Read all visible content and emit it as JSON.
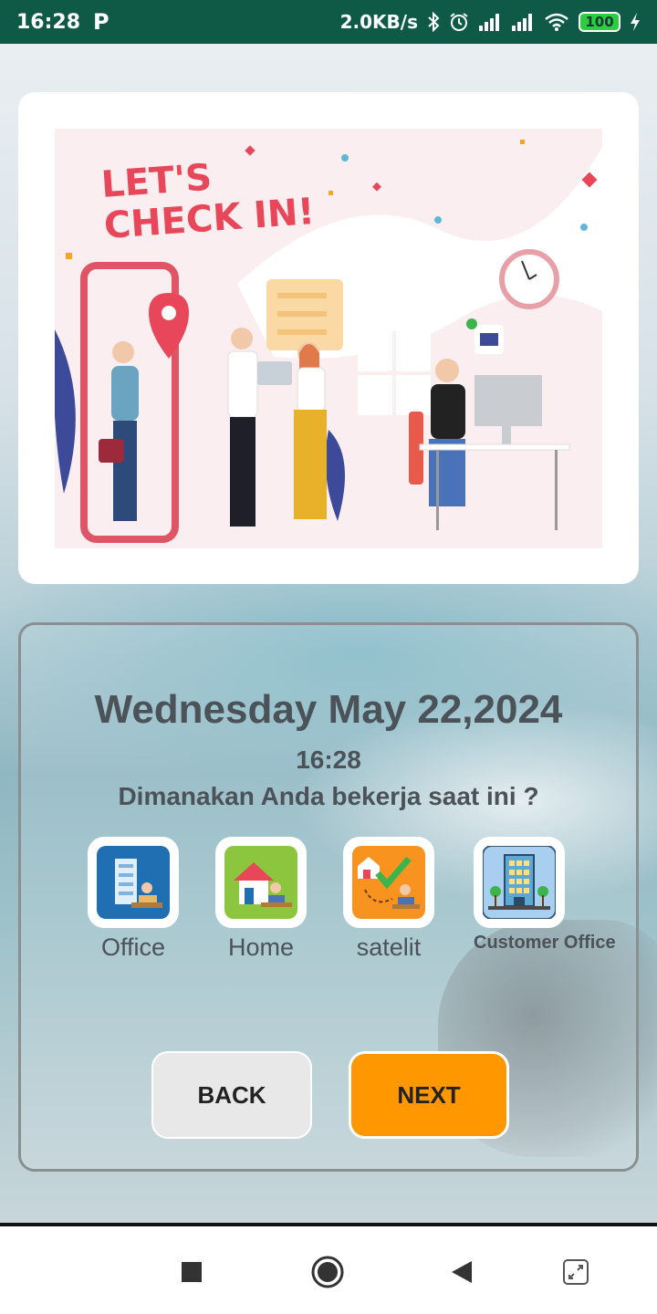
{
  "status_bar": {
    "time": "16:28",
    "app_indicator": "P",
    "net_speed": "2.0KB/s",
    "battery": "100",
    "icons": [
      "bluetooth-icon",
      "alarm-icon",
      "signal-icon",
      "signal-icon",
      "wifi-icon",
      "battery-icon",
      "charging-icon"
    ]
  },
  "banner": {
    "headline_line1": "LET'S",
    "headline_line2": "CHECK IN!"
  },
  "checkin": {
    "date": "Wednesday May 22,2024",
    "time": "16:28",
    "question": "Dimanakan Anda bekerja saat ini ?",
    "options": [
      {
        "label": "Office",
        "icon": "office-building-icon"
      },
      {
        "label": "Home",
        "icon": "home-icon"
      },
      {
        "label": "satelit",
        "icon": "satellite-checkmark-icon"
      },
      {
        "label": "Customer Office",
        "icon": "customer-office-icon"
      }
    ],
    "back_label": "BACK",
    "next_label": "NEXT"
  },
  "colors": {
    "status_bar": "#0e5a47",
    "next_button": "#ff9800",
    "back_button": "#e8e8e8",
    "text": "#4b5258",
    "headline": "#e8475a"
  },
  "nav_bar": {
    "icons": [
      "recents-square-icon",
      "home-circle-icon",
      "back-triangle-icon",
      "screenshot-expand-icon"
    ]
  }
}
